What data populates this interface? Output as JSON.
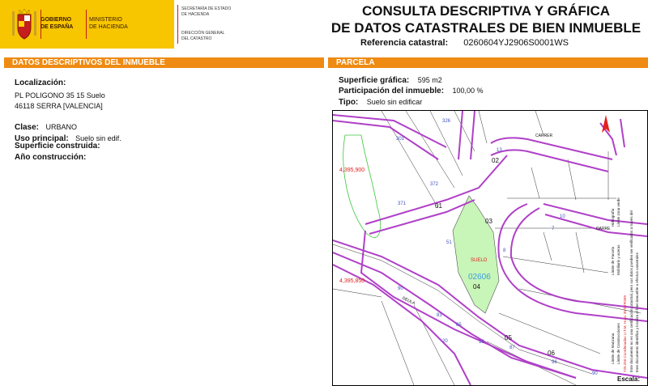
{
  "header": {
    "government": [
      "GOBIERNO",
      "DE ESPAÑA"
    ],
    "ministry": [
      "MINISTERIO",
      "DE HACIENDA"
    ],
    "secretariat": [
      "SECRETARÍA DE ESTADO",
      "DE HACIENDA"
    ],
    "directorate": [
      "DIRECCIÓN GENERAL",
      "DEL CATASTRO"
    ],
    "title_line1": "CONSULTA DESCRIPTIVA Y GRÁFICA",
    "title_line2": "DE DATOS CATASTRALES DE BIEN INMUEBLE",
    "ref_label": "Referencia catastral:",
    "ref_value": "0260604YJ2906S0001WS"
  },
  "left": {
    "section_title": "DATOS DESCRIPTIVOS DEL INMUEBLE",
    "location_label": "Localización:",
    "address_line1": "PL POLIGONO 35 15 Suelo",
    "address_line2": "46118 SERRA [VALENCIA]",
    "class_label": "Clase:",
    "class_value": "URBANO",
    "use_label": "Uso principal:",
    "use_value": "Suelo sin edif.",
    "built_area_label": "Superficie construida:",
    "year_label": "Año construcción:"
  },
  "right": {
    "section_title": "PARCELA",
    "area_label": "Superficie gráfica:",
    "area_value": "595 m2",
    "share_label": "Participación del inmueble:",
    "share_value": "100,00 %",
    "type_label": "Tipo:",
    "type_value": "Suelo sin edificar"
  },
  "map": {
    "coord_top": "4,395,900",
    "coord_mid": "4,395,850",
    "parcel_tag": "SUELO",
    "parcel_code": "02606",
    "lots": [
      "01",
      "02",
      "03",
      "04",
      "05",
      "06"
    ],
    "street_labels": [
      "CARRER",
      "CARRE",
      "DEULA"
    ],
    "numbers": [
      "301",
      "302",
      "326",
      "372",
      "371",
      "13",
      "51",
      "10",
      "7",
      "8",
      "6",
      "90",
      "83",
      "65",
      "20",
      "19",
      "88",
      "87",
      "96",
      "90"
    ],
    "legend": [
      "Límite de Manzana",
      "Límite de Parcela",
      "Límite de Construcciones",
      "Mobiliario y aceras",
      "Límite zona verde",
      "Hidrografía",
      "720.250 Coordenadas U.T.M. Huso 30 ETRS89",
      "Este documento no es una certificación catastral, pero sus datos pueden ser verificados a través del",
      "Este documento identifica y localiza el bien inmueble a efectos catastrales"
    ],
    "scale_label": "Escala:"
  },
  "colors": {
    "header_yellow": "#f7c600",
    "orange": "#ef8a12",
    "purple": "#b040c8",
    "parcel_green": "#c8f5b8",
    "coord_red": "#e22020"
  }
}
